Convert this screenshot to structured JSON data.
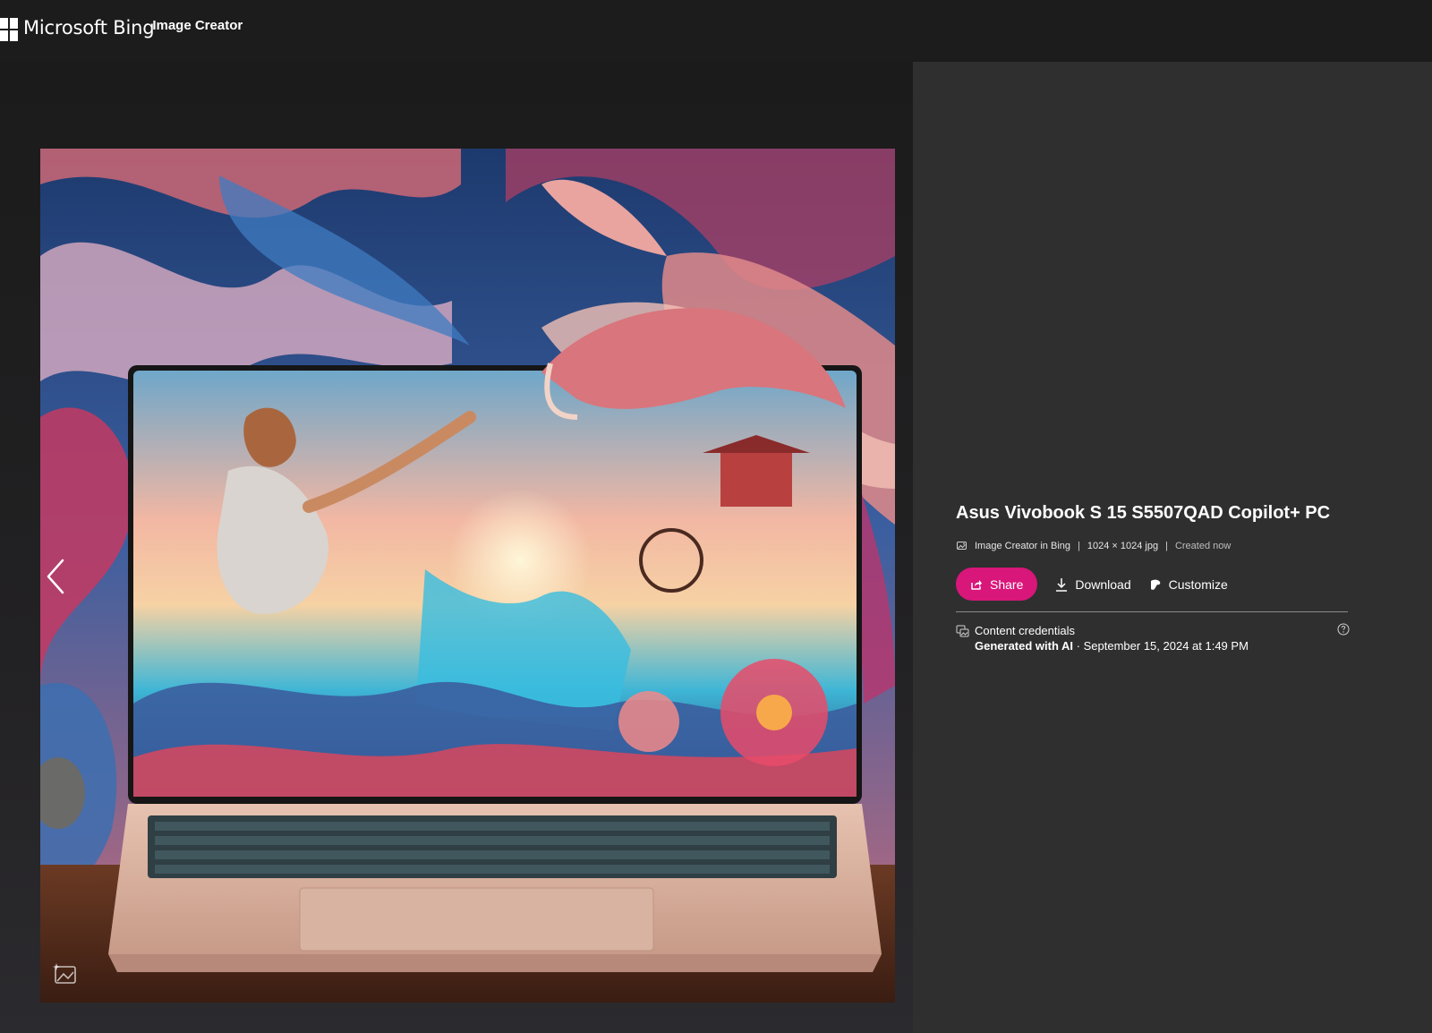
{
  "header": {
    "brand": "Microsoft Bing",
    "product": "Image Creator",
    "logo_icon": "microsoft-logo-icon"
  },
  "viewer": {
    "prev_icon": "chevron-left-icon",
    "watermark_icon": "ai-image-watermark-icon",
    "image_description": "AI-generated artwork of an Asus laptop with fantasy dragons and landscape"
  },
  "details": {
    "title": "Asus Vivobook S 15 S5507QAD Copilot+ PC",
    "meta": {
      "source": "Image Creator in Bing",
      "separator": "|",
      "dimensions": "1024 × 1024 jpg",
      "created": "Created now"
    },
    "actions": {
      "share": "Share",
      "download": "Download",
      "customize": "Customize"
    },
    "credentials": {
      "label": "Content credentials",
      "generated": "Generated with AI",
      "date": "· September 15, 2024 at 1:49 PM"
    }
  },
  "colors": {
    "accent": "#d9167a",
    "panel": "#2f2f2f",
    "background": "#1b1b1b"
  }
}
